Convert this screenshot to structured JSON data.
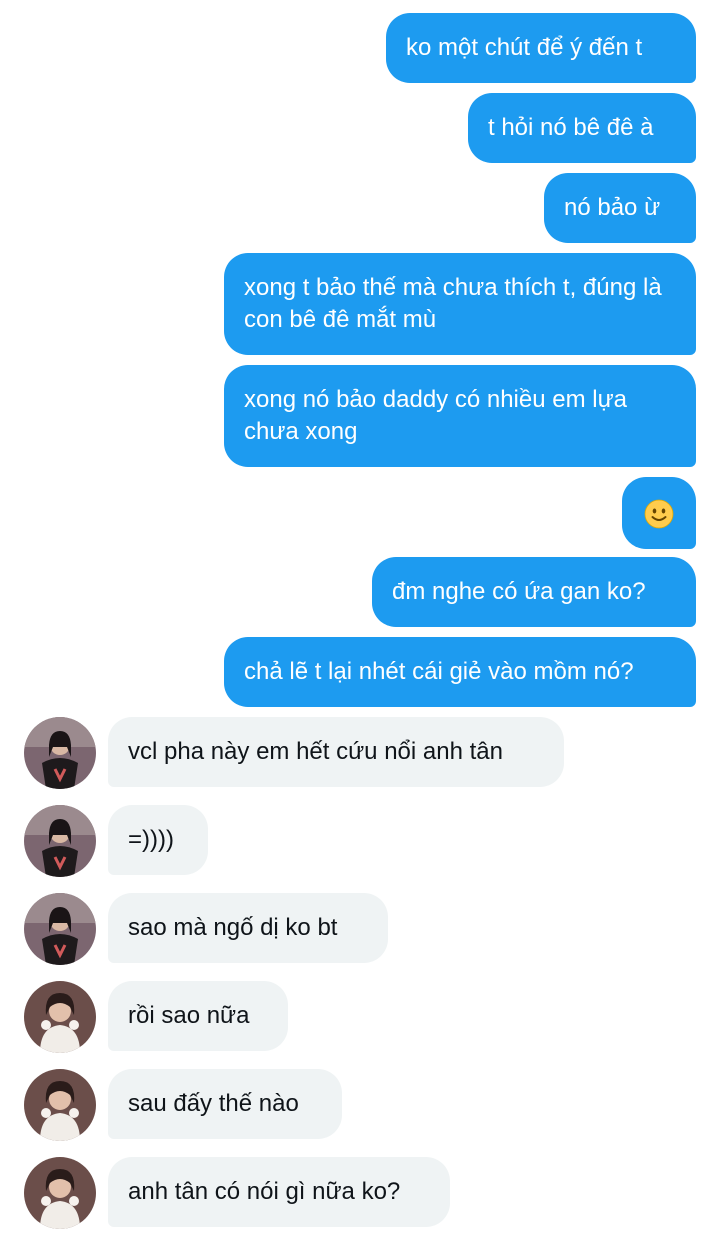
{
  "conversation": {
    "messages": [
      {
        "side": "out",
        "text": "ko một chút để ý đến t"
      },
      {
        "side": "out",
        "text": "t hỏi nó bê đê à"
      },
      {
        "side": "out",
        "text": "nó bảo ừ"
      },
      {
        "side": "out",
        "text": "xong t bảo thế mà chưa thích t, đúng là con bê đê mắt mù"
      },
      {
        "side": "out",
        "text": "xong nó bảo daddy có nhiều em lựa chưa xong"
      },
      {
        "side": "out",
        "text": "",
        "emoji": "slightly-smiling-face-emoji"
      },
      {
        "side": "out",
        "text": "đm nghe có ứa gan ko?"
      },
      {
        "side": "out",
        "text": "chả lẽ t lại nhét cái giẻ vào mồm nó?"
      },
      {
        "side": "in",
        "avatar": "user-a-avatar",
        "text": "vcl pha này em hết cứu nổi anh tân"
      },
      {
        "side": "in",
        "avatar": "user-a-avatar",
        "text": "=))))"
      },
      {
        "side": "in",
        "avatar": "user-a-avatar",
        "text": "sao mà ngố dị ko bt"
      },
      {
        "side": "in",
        "avatar": "user-b-avatar",
        "text": "rồi sao nữa"
      },
      {
        "side": "in",
        "avatar": "user-b-avatar",
        "text": "sau đấy thế nào"
      },
      {
        "side": "in",
        "avatar": "user-b-avatar",
        "text": "anh tân có nói gì nữa ko?"
      }
    ]
  },
  "colors": {
    "outgoing_bubble": "#1d9bf0",
    "incoming_bubble": "#eff3f4",
    "outgoing_text": "#ffffff",
    "incoming_text": "#0f1419"
  }
}
